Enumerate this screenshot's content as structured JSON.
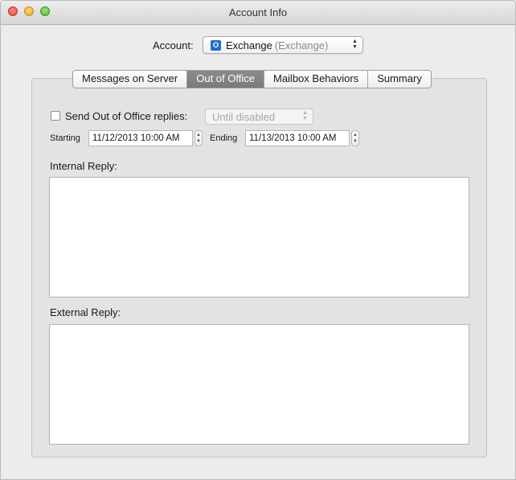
{
  "window": {
    "title": "Account Info"
  },
  "account": {
    "label": "Account:",
    "selected_name": "Exchange",
    "selected_type": "(Exchange)",
    "icon": "exchange-icon"
  },
  "tabs": [
    {
      "label": "Messages on Server",
      "active": false
    },
    {
      "label": "Out of Office",
      "active": true
    },
    {
      "label": "Mailbox Behaviors",
      "active": false
    },
    {
      "label": "Summary",
      "active": false
    }
  ],
  "out_of_office": {
    "send_replies_label": "Send Out of Office replies:",
    "send_replies_checked": false,
    "duration_value": "Until disabled",
    "starting_label": "Starting",
    "starting_value": "11/12/2013 10:00 AM",
    "ending_label": "Ending",
    "ending_value": "11/13/2013 10:00 AM",
    "internal_reply_label": "Internal Reply:",
    "internal_reply_value": "",
    "external_reply_label": "External Reply:",
    "external_reply_value": ""
  },
  "colors": {
    "active_tab": "#808080",
    "window_bg": "#ececec",
    "exchange_icon": "#1e6fd0"
  }
}
